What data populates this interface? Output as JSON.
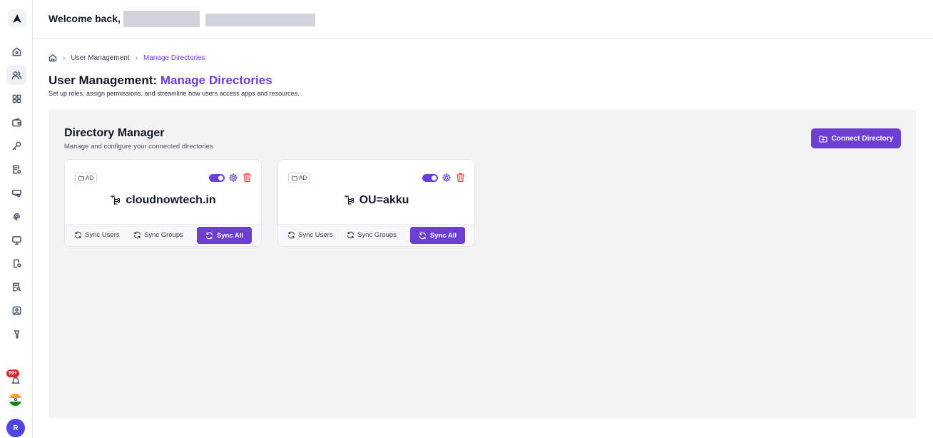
{
  "header": {
    "welcome": "Welcome back,"
  },
  "breadcrumb": {
    "home_icon": "home-icon",
    "items": [
      "User Management",
      "Manage Directories"
    ]
  },
  "page": {
    "title_prefix": "User Management:",
    "title_accent": "Manage Directories",
    "subtitle": "Set up roles, assign permissions, and streamline how users access apps and resources."
  },
  "panel": {
    "title": "Directory Manager",
    "subtitle": "Manage and configure your connected directories",
    "connect_label": "Connect Directory"
  },
  "cards": [
    {
      "tag": "AD",
      "name": "cloudnowtech.in",
      "sync_users": "Sync Users",
      "sync_groups": "Sync Groups",
      "sync_all": "Sync All",
      "enabled": true
    },
    {
      "tag": "AD",
      "name": "OU=akku",
      "sync_users": "Sync Users",
      "sync_groups": "Sync Groups",
      "sync_all": "Sync All",
      "enabled": true
    }
  ],
  "sidebar": {
    "items": [
      "home-icon",
      "users-icon",
      "apps-grid-icon",
      "wallet-icon",
      "key-icon",
      "document-settings-icon",
      "device-key-icon",
      "fingerprint-icon",
      "monitor-icon",
      "mobile-settings-icon",
      "report-search-icon",
      "id-card-icon",
      "magic-wand-icon"
    ],
    "active": "users-icon",
    "notification_badge": "99+",
    "avatar_initial": "R"
  },
  "colors": {
    "accent": "#6d3fd1",
    "danger": "#ef4444",
    "panel_bg": "#f3f3f3"
  }
}
